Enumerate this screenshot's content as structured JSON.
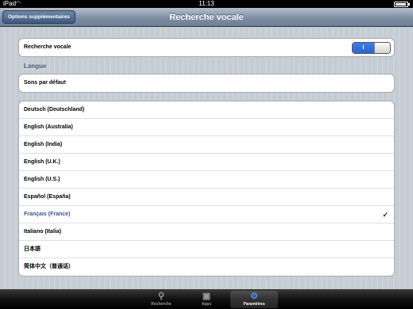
{
  "status_bar": {
    "carrier": "iPad",
    "time": "11:13"
  },
  "nav": {
    "back_label": "Options supplémentaires",
    "title": "Recherche vocale"
  },
  "voice_search": {
    "label": "Recherche vocale",
    "toggle_label": "I",
    "toggle_on": true
  },
  "language_section": {
    "header": "Langue"
  },
  "default_sounds": {
    "label": "Sons par défaut"
  },
  "languages": [
    {
      "label": "Deutsch (Deutschland)",
      "selected": false
    },
    {
      "label": "English (Australia)",
      "selected": false
    },
    {
      "label": "English (India)",
      "selected": false
    },
    {
      "label": "English (U.K.)",
      "selected": false
    },
    {
      "label": "English (U.S.)",
      "selected": false
    },
    {
      "label": "Español (España)",
      "selected": false
    },
    {
      "label": "Français (France)",
      "selected": true
    },
    {
      "label": "Italiano (Italia)",
      "selected": false
    },
    {
      "label": "日本語",
      "selected": false
    },
    {
      "label": "简体中文（普通话）",
      "selected": false
    }
  ],
  "checkmark": "✓",
  "tabs": [
    {
      "label": "Recherche",
      "icon": "search-icon",
      "active": false
    },
    {
      "label": "Apps",
      "icon": "apps-icon",
      "active": false
    },
    {
      "label": "Paramètres",
      "icon": "gear-icon",
      "active": true
    }
  ]
}
